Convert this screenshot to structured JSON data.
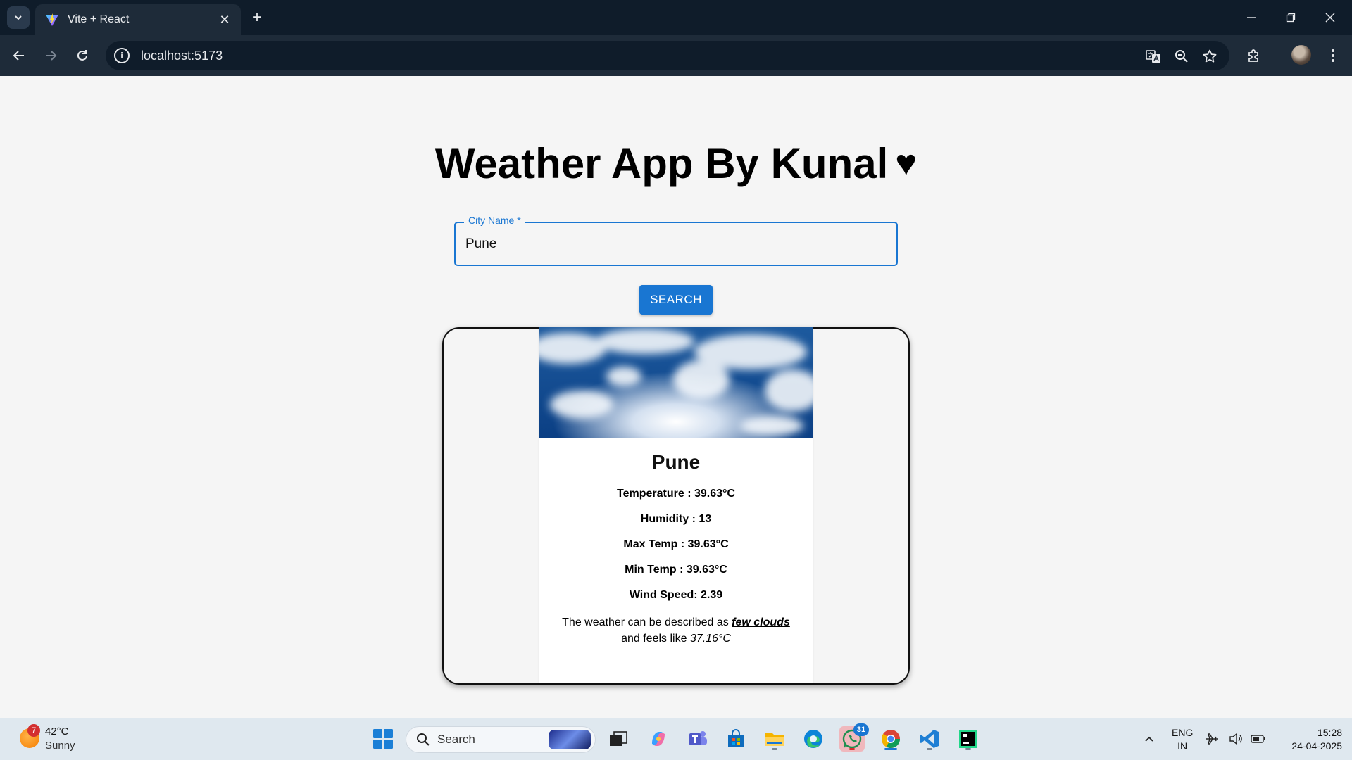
{
  "browser": {
    "tab_title": "Vite + React",
    "url": "localhost:5173",
    "new_tab_symbol": "+",
    "close_symbol": "✕"
  },
  "page": {
    "title": "Weather App By Kunal",
    "heart": "♥",
    "field_label": "City Name *",
    "field_value": "Pune",
    "search_label": "SEARCH"
  },
  "card": {
    "city": "Pune",
    "temperature": "Temperature : 39.63°C",
    "humidity": "Humidity : 13",
    "max_temp": "Max Temp : 39.63°C",
    "min_temp": "Min Temp : 39.63°C",
    "wind": "Wind Speed: 2.39",
    "desc_prefix": "The weather can be described as ",
    "condition": "few clouds",
    "desc_mid": "and feels like ",
    "feels_like": "37.16°C"
  },
  "taskbar": {
    "weather_badge": "7",
    "weather_temp": "42°C",
    "weather_cond": "Sunny",
    "search_placeholder": "Search",
    "whatsapp_badge": "31",
    "lang_top": "ENG",
    "lang_bottom": "IN",
    "time": "15:28",
    "date": "24-04-2025"
  },
  "colors": {
    "accent": "#1976d2",
    "chrome_dark": "#0f1c2a",
    "chrome_toolbar": "#1e2b39",
    "page_bg": "#f5f5f5"
  },
  "icons": [
    "tab-search-icon",
    "vite-favicon-icon",
    "back-icon",
    "forward-icon",
    "reload-icon",
    "site-info-icon",
    "translate-icon",
    "zoom-icon",
    "star-icon",
    "extensions-icon",
    "menu-icon",
    "windows-start-icon",
    "search-icon"
  ]
}
